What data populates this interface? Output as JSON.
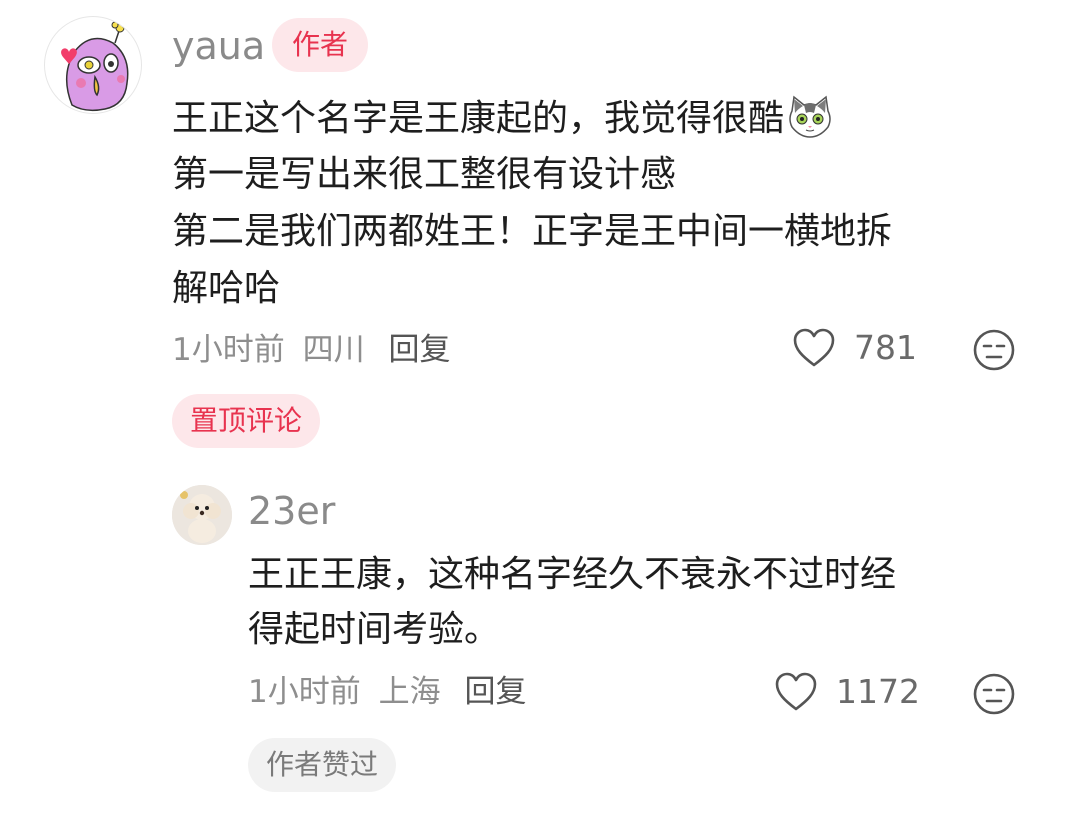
{
  "comments": [
    {
      "username": "yaua",
      "badge": "作者",
      "lines": [
        "王正这个名字是王康起的，我觉得很酷",
        "第一是写出来很工整很有设计感",
        "第二是我们两都姓王！正字是王中间一横地拆",
        "解哈哈"
      ],
      "inline_emoji": "cat-emoji",
      "time": "1小时前",
      "location": "四川",
      "reply_label": "回复",
      "like_count": "781",
      "tag": "置顶评论"
    },
    {
      "username": "23er",
      "lines": [
        "王正王康，这种名字经久不衰永不过时经",
        "得起时间考验。"
      ],
      "time": "1小时前",
      "location": "上海",
      "reply_label": "回复",
      "like_count": "1172",
      "tag": "作者赞过"
    }
  ],
  "colors": {
    "accent_red": "#e8334f",
    "badge_bg": "#fde7ea",
    "muted_text": "#8e8e8e",
    "username": "#8a8a8a"
  },
  "icons": {
    "like": "heart-outline-icon",
    "dislike": "meh-face-icon"
  }
}
